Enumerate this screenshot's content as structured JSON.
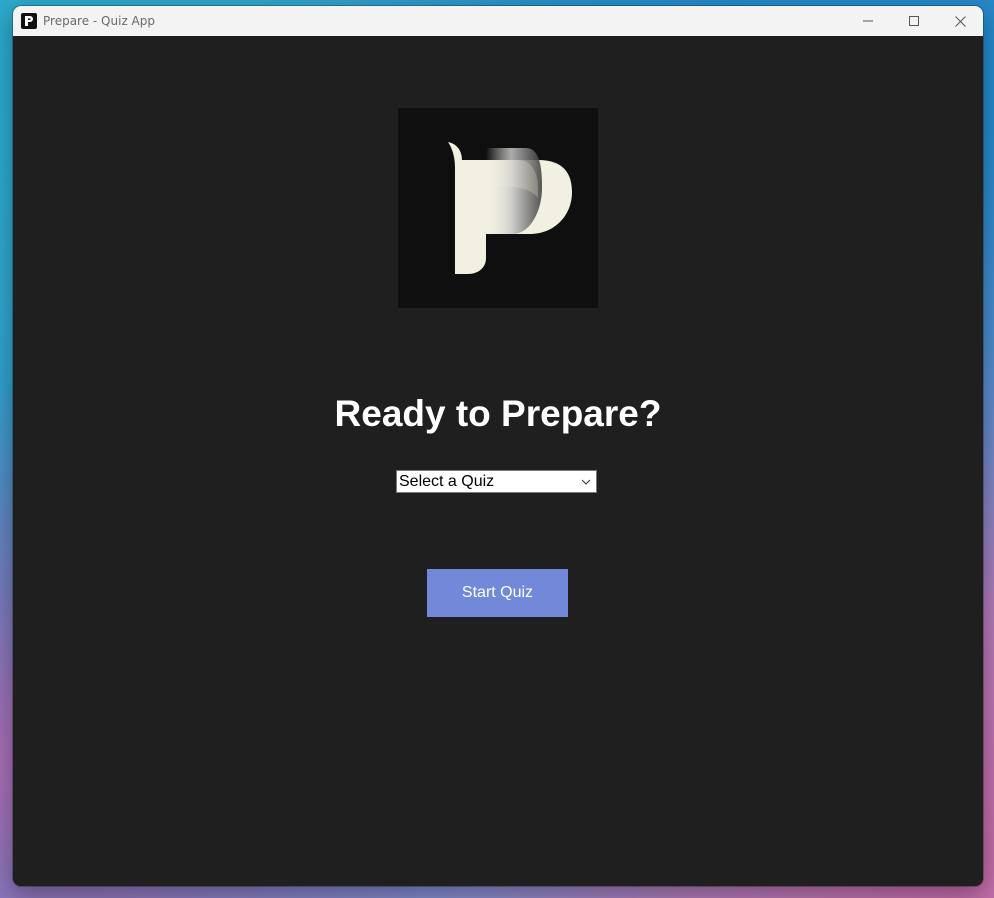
{
  "window": {
    "title": "Prepare - Quiz App",
    "app_icon": "prepare-logo-icon",
    "controls": [
      "minimize-icon",
      "maximize-icon",
      "close-icon"
    ]
  },
  "main": {
    "logo_icon": "prepare-p-logo",
    "heading": "Ready to Prepare?",
    "quiz_select": {
      "selected": "Select a Quiz",
      "icon": "chevron-down-icon"
    },
    "start_button_label": "Start Quiz"
  },
  "colors": {
    "background": "#1f1f1f",
    "accent": "#7289da",
    "logo_fill": "#f2f0e0"
  }
}
